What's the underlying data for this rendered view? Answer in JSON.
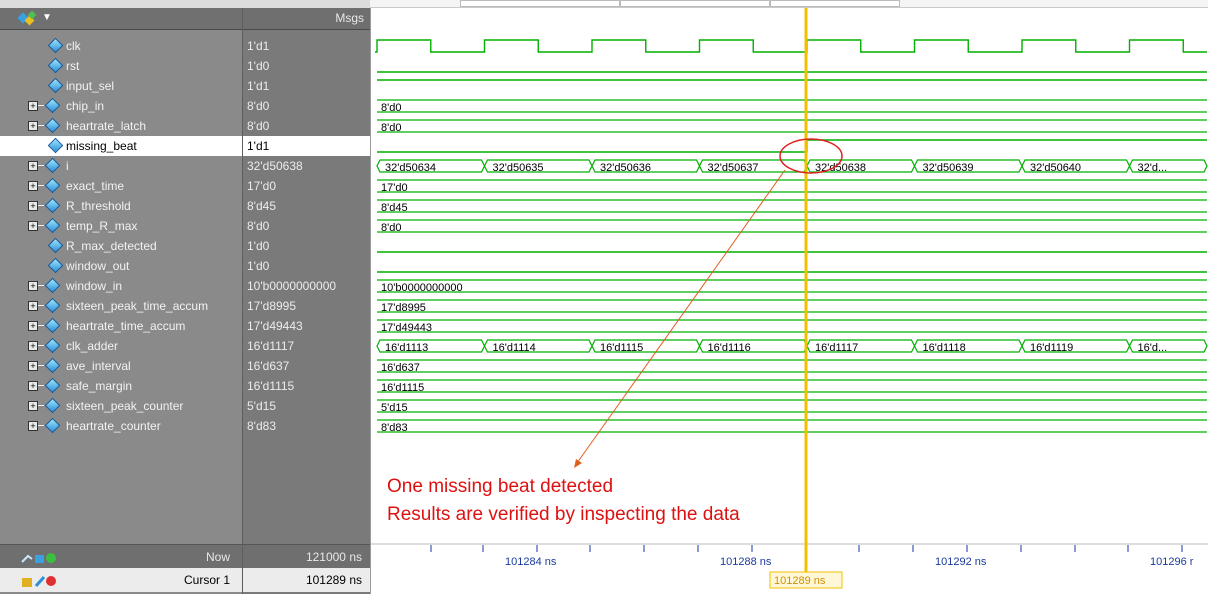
{
  "header": {
    "msgs_label": "Msgs"
  },
  "signals": [
    {
      "name": "clk",
      "value": "1'd1",
      "expandable": false
    },
    {
      "name": "rst",
      "value": "1'd0",
      "expandable": false
    },
    {
      "name": "input_sel",
      "value": "1'd1",
      "expandable": false
    },
    {
      "name": "chip_in",
      "value": "8'd0",
      "expandable": true
    },
    {
      "name": "heartrate_latch",
      "value": "8'd0",
      "expandable": true
    },
    {
      "name": "missing_beat",
      "value": "1'd1",
      "expandable": false,
      "selected": true
    },
    {
      "name": "i",
      "value": "32'd50638",
      "expandable": true
    },
    {
      "name": "exact_time",
      "value": "17'd0",
      "expandable": true
    },
    {
      "name": "R_threshold",
      "value": "8'd45",
      "expandable": true
    },
    {
      "name": "temp_R_max",
      "value": "8'd0",
      "expandable": true
    },
    {
      "name": "R_max_detected",
      "value": "1'd0",
      "expandable": false
    },
    {
      "name": "window_out",
      "value": "1'd0",
      "expandable": false
    },
    {
      "name": "window_in",
      "value": "10'b0000000000",
      "expandable": true
    },
    {
      "name": "sixteen_peak_time_accum",
      "value": "17'd8995",
      "expandable": true
    },
    {
      "name": "heartrate_time_accum",
      "value": "17'd49443",
      "expandable": true
    },
    {
      "name": "clk_adder",
      "value": "16'd1117",
      "expandable": true
    },
    {
      "name": "ave_interval",
      "value": "16'd637",
      "expandable": true
    },
    {
      "name": "safe_margin",
      "value": "16'd1115",
      "expandable": true
    },
    {
      "name": "sixteen_peak_counter",
      "value": "5'd15",
      "expandable": true
    },
    {
      "name": "heartrate_counter",
      "value": "8'd83",
      "expandable": true
    }
  ],
  "bus_labels": {
    "chip_in": [
      "8'd0"
    ],
    "heartrate_latch": [
      "8'd0"
    ],
    "i": [
      "32'd50634",
      "32'd50635",
      "32'd50636",
      "32'd50637",
      "32'd50638",
      "32'd50639",
      "32'd50640",
      "32'd..."
    ],
    "exact_time": [
      "17'd0"
    ],
    "R_threshold": [
      "8'd45"
    ],
    "temp_R_max": [
      "8'd0"
    ],
    "window_in": [
      "10'b0000000000"
    ],
    "sixteen_peak_time_accum": [
      "17'd8995"
    ],
    "heartrate_time_accum": [
      "17'd49443"
    ],
    "clk_adder": [
      "16'd1113",
      "16'd1114",
      "16'd1115",
      "16'd1116",
      "16'd1117",
      "16'd1118",
      "16'd1119",
      "16'd..."
    ],
    "ave_interval": [
      "16'd637"
    ],
    "safe_margin": [
      "16'd1115"
    ],
    "sixteen_peak_counter": [
      "5'd15"
    ],
    "heartrate_counter": [
      "8'd83"
    ]
  },
  "footer": {
    "now_label": "Now",
    "now_value": "121000 ns",
    "cursor_label": "Cursor 1",
    "cursor_value": "101289 ns"
  },
  "timeline": {
    "ticks": [
      "101284 ns",
      "101288 ns",
      "101292 ns",
      "101296 r"
    ],
    "cursor_label": "101289 ns"
  },
  "annotation": {
    "line1": "One missing beat detected",
    "line2": "Results are verified by inspecting the data"
  },
  "colors": {
    "wave": "#00b000",
    "cursor": "#f0c000",
    "annotation": "#d11111",
    "pane": "#8a8a8a"
  }
}
